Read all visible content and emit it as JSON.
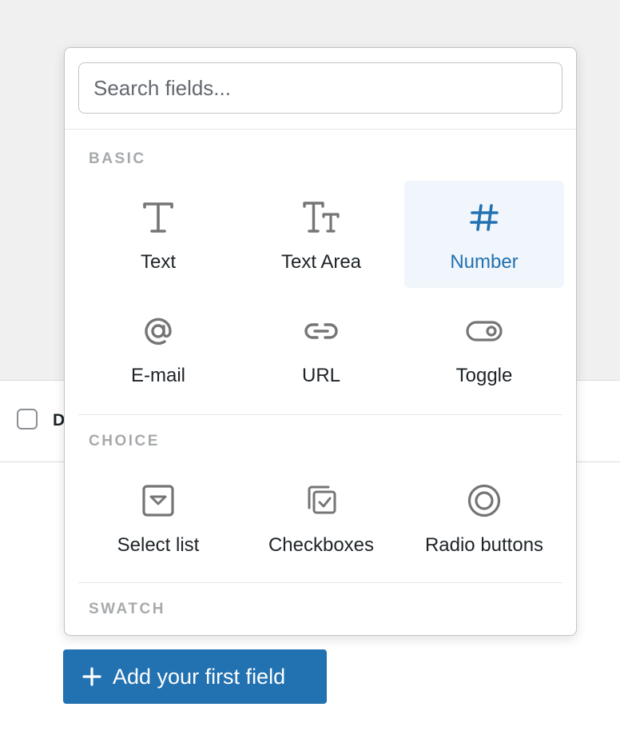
{
  "search": {
    "placeholder": "Search fields..."
  },
  "sections": [
    {
      "title": "BASIC",
      "items": [
        {
          "label": "Text",
          "icon": "text-icon"
        },
        {
          "label": "Text Area",
          "icon": "text-area-icon"
        },
        {
          "label": "Number",
          "icon": "hash-icon",
          "active": true
        },
        {
          "label": "E-mail",
          "icon": "at-icon"
        },
        {
          "label": "URL",
          "icon": "link-icon"
        },
        {
          "label": "Toggle",
          "icon": "toggle-icon"
        }
      ]
    },
    {
      "title": "CHOICE",
      "items": [
        {
          "label": "Select list",
          "icon": "select-list-icon"
        },
        {
          "label": "Checkboxes",
          "icon": "checkboxes-icon"
        },
        {
          "label": "Radio buttons",
          "icon": "radio-icon"
        }
      ]
    },
    {
      "title": "SWATCH",
      "items": []
    }
  ],
  "background": {
    "column_label": "D"
  },
  "add_button": {
    "label": "Add your first field",
    "icon": "plus-icon"
  },
  "colors": {
    "accent": "#2271b1",
    "active_bg": "#f0f6fb",
    "muted": "#a7aaad"
  }
}
